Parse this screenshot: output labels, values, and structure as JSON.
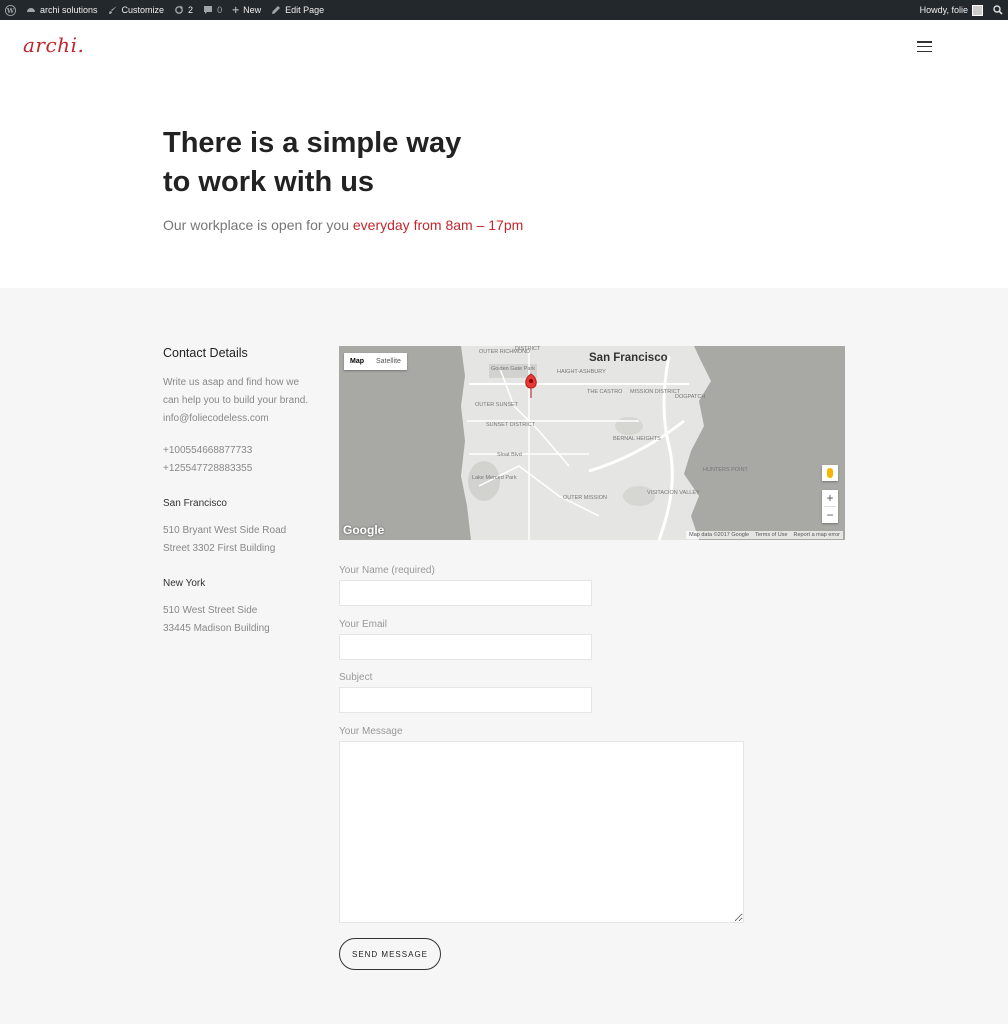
{
  "adminbar": {
    "wp_icon": "wordpress-icon",
    "site_name": "archi solutions",
    "customize": "Customize",
    "updates_count": "2",
    "comments_count": "0",
    "new_label": "New",
    "edit_page": "Edit Page",
    "howdy": "Howdy, folie",
    "search_icon": "search-icon"
  },
  "header": {
    "logo": "archi."
  },
  "hero": {
    "title_line1": "There is a simple way",
    "title_line2": "to work with us",
    "subtitle_prefix": "Our workplace is open for you ",
    "subtitle_accent": "everyday from 8am – 17pm"
  },
  "contact": {
    "heading": "Contact Details",
    "intro_line1": "Write us asap and find how we",
    "intro_line2": "can help you to build your brand.",
    "email": "info@foliecodeless.com",
    "phone1": "+100554668877733",
    "phone2": "+125547728883355",
    "office1_title": "San Francisco",
    "office1_line1": "510 Bryant West Side Road",
    "office1_line2": "Street 3302 First Building",
    "office2_title": "New York",
    "office2_line1": "510  West Street Side",
    "office2_line2": "33445 Madison Building"
  },
  "map": {
    "type_map": "Map",
    "type_satellite": "Satellite",
    "city": "San Francisco",
    "labels": {
      "outer_richmond": "OUTER RICHMOND",
      "district": "DISTRICT",
      "golden_gate": "Golden Gate Park",
      "haight": "HAIGHT-ASHBURY",
      "outer_sunset": "OUTER SUNSET",
      "castro": "THE CASTRO",
      "mission": "MISSION DISTRICT",
      "dogpatch": "DOGPATCH",
      "sunset": "SUNSET DISTRICT",
      "bernal": "BERNAL HEIGHTS",
      "sloat": "Sloat Blvd",
      "hunters": "HUNTERS POINT",
      "lake_merced": "Lake Merced Park",
      "outer_mission": "OUTER MISSION",
      "visitacion": "VISITACION VALLEY"
    },
    "google": "Google",
    "map_data": "Map data ©2017 Google",
    "terms": "Terms of Use",
    "report": "Report a map error",
    "zoom_in": "+",
    "zoom_out": "−"
  },
  "form": {
    "name_label": "Your Name (required)",
    "email_label": "Your Email",
    "subject_label": "Subject",
    "message_label": "Your Message",
    "name_value": "",
    "email_value": "",
    "subject_value": "",
    "message_value": "",
    "send_label": "SEND MESSAGE"
  },
  "colors": {
    "accent": "#c0282e",
    "adminbar_bg": "#23282d",
    "section_bg": "#f6f6f6"
  }
}
